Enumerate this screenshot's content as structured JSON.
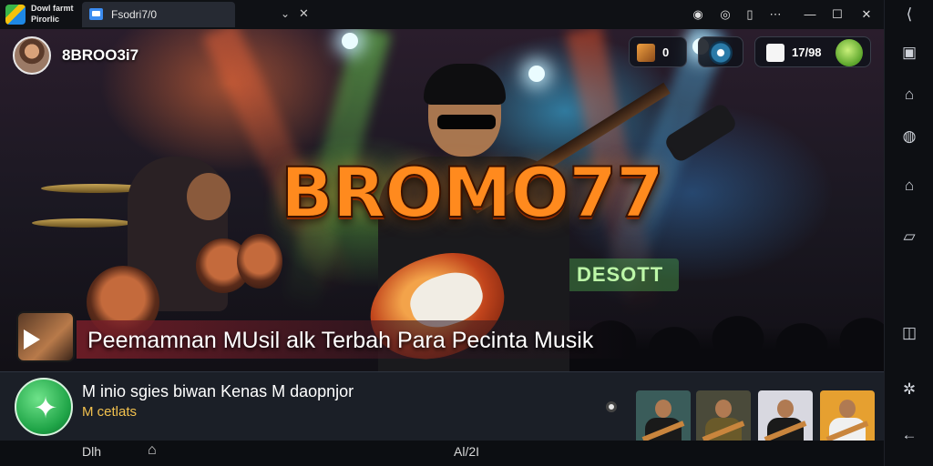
{
  "app": {
    "name": "Dowl farmt Pirorlic",
    "icon": "multicolor-app-icon",
    "tab": {
      "title": "Fsodri7/0",
      "icon": "window-icon",
      "chevron_icon": "chevron-down-icon",
      "close_icon": "close-icon"
    }
  },
  "titlebar_controls": [
    {
      "name": "account-icon",
      "glyph": "◉"
    },
    {
      "name": "help-icon",
      "glyph": "◎"
    },
    {
      "name": "bookmark-icon",
      "glyph": "▯"
    },
    {
      "name": "menu-dots-icon",
      "glyph": "⋯"
    },
    {
      "name": "minimize-icon",
      "glyph": "—"
    },
    {
      "name": "maximize-icon",
      "glyph": "☐"
    },
    {
      "name": "close-window-icon",
      "glyph": "✕"
    }
  ],
  "sidebar": [
    {
      "name": "collapse-icon",
      "glyph": "⟨"
    },
    {
      "name": "screen-icon",
      "glyph": "▣"
    },
    {
      "name": "user-icon",
      "glyph": "⌂"
    },
    {
      "name": "location-icon",
      "glyph": "◍"
    },
    {
      "name": "home-icon",
      "glyph": "⌂"
    },
    {
      "name": "files-icon",
      "glyph": "▱"
    },
    {
      "name": "rotate-icon",
      "glyph": "◫"
    },
    {
      "name": "settings-icon",
      "glyph": "✲"
    },
    {
      "name": "back-icon",
      "glyph": "←"
    }
  ],
  "stream": {
    "profile_name": "8BROO3i7",
    "brand": "BROMO77",
    "screen_sign": "CI DESOTT",
    "caption": "Peemamnan MUsil alk Terbah Para Pecinta Musik",
    "pills": [
      {
        "label": "0",
        "icon": "gallery-icon"
      },
      {
        "label": "",
        "icon": "live-icon"
      },
      {
        "label": "17/98",
        "icon": "gift-icon"
      }
    ]
  },
  "panel": {
    "title": "M inio sgies biwan Kenas M daopnjor",
    "subtitle": "M cetlats",
    "icon": "star-check-icon",
    "thumbnails": [
      {
        "label": "video-thumbnail-1",
        "bg": "#3a5c5a"
      },
      {
        "label": "video-thumbnail-2",
        "bg": "#4a4a3a"
      },
      {
        "label": "video-thumbnail-3",
        "bg": "#d8d8e0"
      },
      {
        "label": "video-thumbnail-4",
        "bg": "#e6a030"
      }
    ]
  },
  "navbar": {
    "left": "Dlh",
    "center": "Al/2I",
    "home_icon": "home-outline-icon"
  },
  "colors": {
    "brand_orange": "#ff8a1e",
    "panel_bg": "#1b1f27",
    "subtitle_gold": "#f2c14e",
    "accent_green": "#1fa447"
  }
}
